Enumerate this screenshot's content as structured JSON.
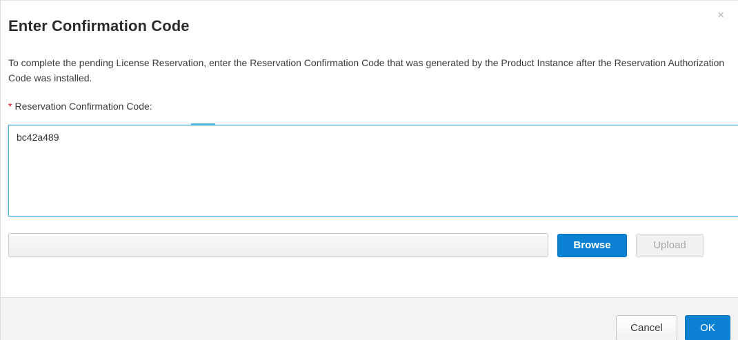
{
  "dialog": {
    "title": "Enter Confirmation Code",
    "close_glyph": "×",
    "description": "To complete the pending License Reservation, enter the Reservation Confirmation Code that was generated by the Product Instance after the Reservation Authorization Code was installed.",
    "field": {
      "required_marker": "*",
      "label": "Reservation Confirmation Code:",
      "value": "bc42a489"
    },
    "file": {
      "value": "",
      "browse_label": "Browse",
      "upload_label": "Upload"
    },
    "footer": {
      "cancel_label": "Cancel",
      "ok_label": "OK"
    }
  },
  "colors": {
    "primary_button": "#0b82d1",
    "focus_border": "#4fb0e3",
    "required": "#d0021b",
    "footer_bg": "#f3f3f3"
  },
  "icons": {
    "close": "close-icon"
  }
}
